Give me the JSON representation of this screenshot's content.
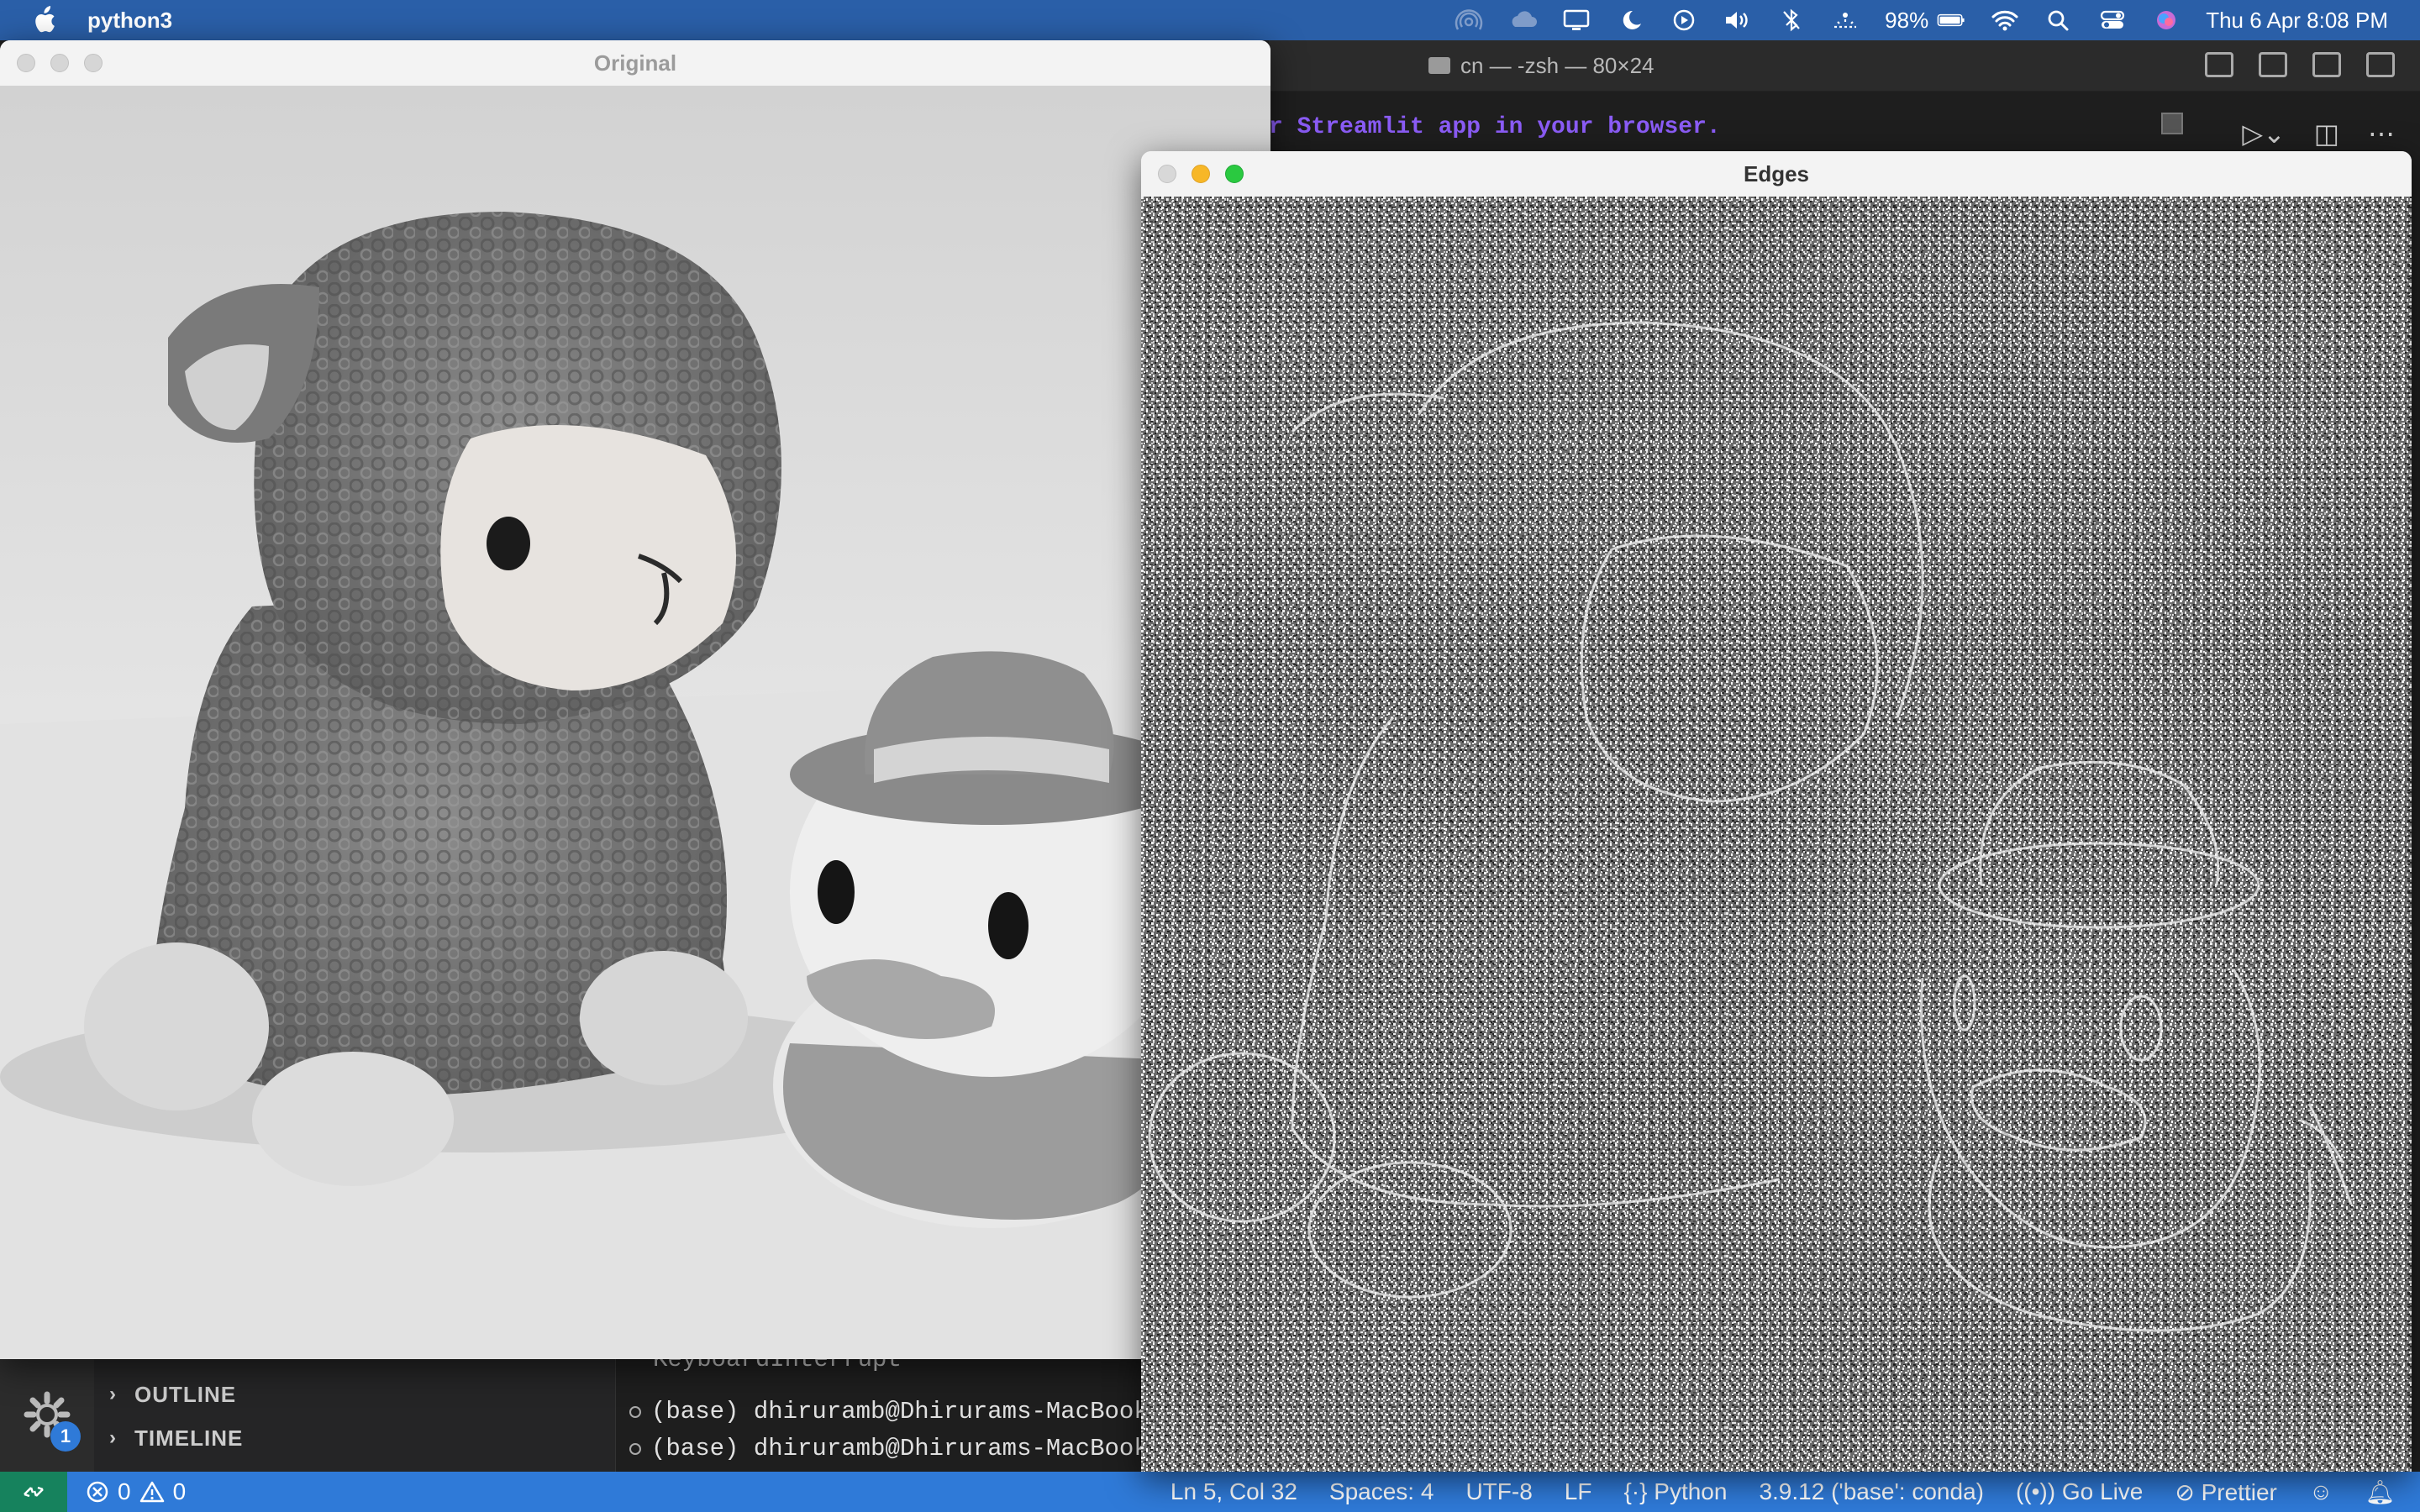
{
  "menubar": {
    "app_name": "python3",
    "battery_percent": "98%",
    "clock": "Thu 6 Apr  8:08 PM",
    "icons": [
      "airdrop-icon",
      "cloud-icon",
      "display-icon",
      "do-not-disturb-icon",
      "play-icon",
      "volume-icon",
      "bluetooth-icon",
      "network-icon",
      "battery-icon",
      "wifi-icon",
      "search-icon",
      "control-center-icon",
      "siri-icon"
    ]
  },
  "vscode": {
    "terminal_title": "cn — -zsh — 80×24",
    "terminal_text": "r Streamlit app in your browser.",
    "sidebar": {
      "outline_label": "OUTLINE",
      "timeline_label": "TIMELINE"
    },
    "manage_badge": "1",
    "terminal_lines": [
      "KeyboardInterrupt",
      "(base) dhiruramb@Dhirurams-MacBook",
      "(base) dhiruramb@Dhirurams-MacBook"
    ],
    "statusbar": {
      "errors": "0",
      "warnings": "0",
      "cursor": "Ln 5, Col 32",
      "spaces": "Spaces: 4",
      "encoding": "UTF-8",
      "eol": "LF",
      "language": "Python",
      "interpreter": "3.9.12 ('base': conda)",
      "golive": "Go Live",
      "prettier": "Prettier"
    }
  },
  "windows": {
    "original_title": "Original",
    "edges_title": "Edges"
  },
  "colors": {
    "menubar": "#2a5fa8",
    "statusbar": "#2f7ad8",
    "remote": "#16825d",
    "terminal_purple": "#8b5cf6"
  }
}
